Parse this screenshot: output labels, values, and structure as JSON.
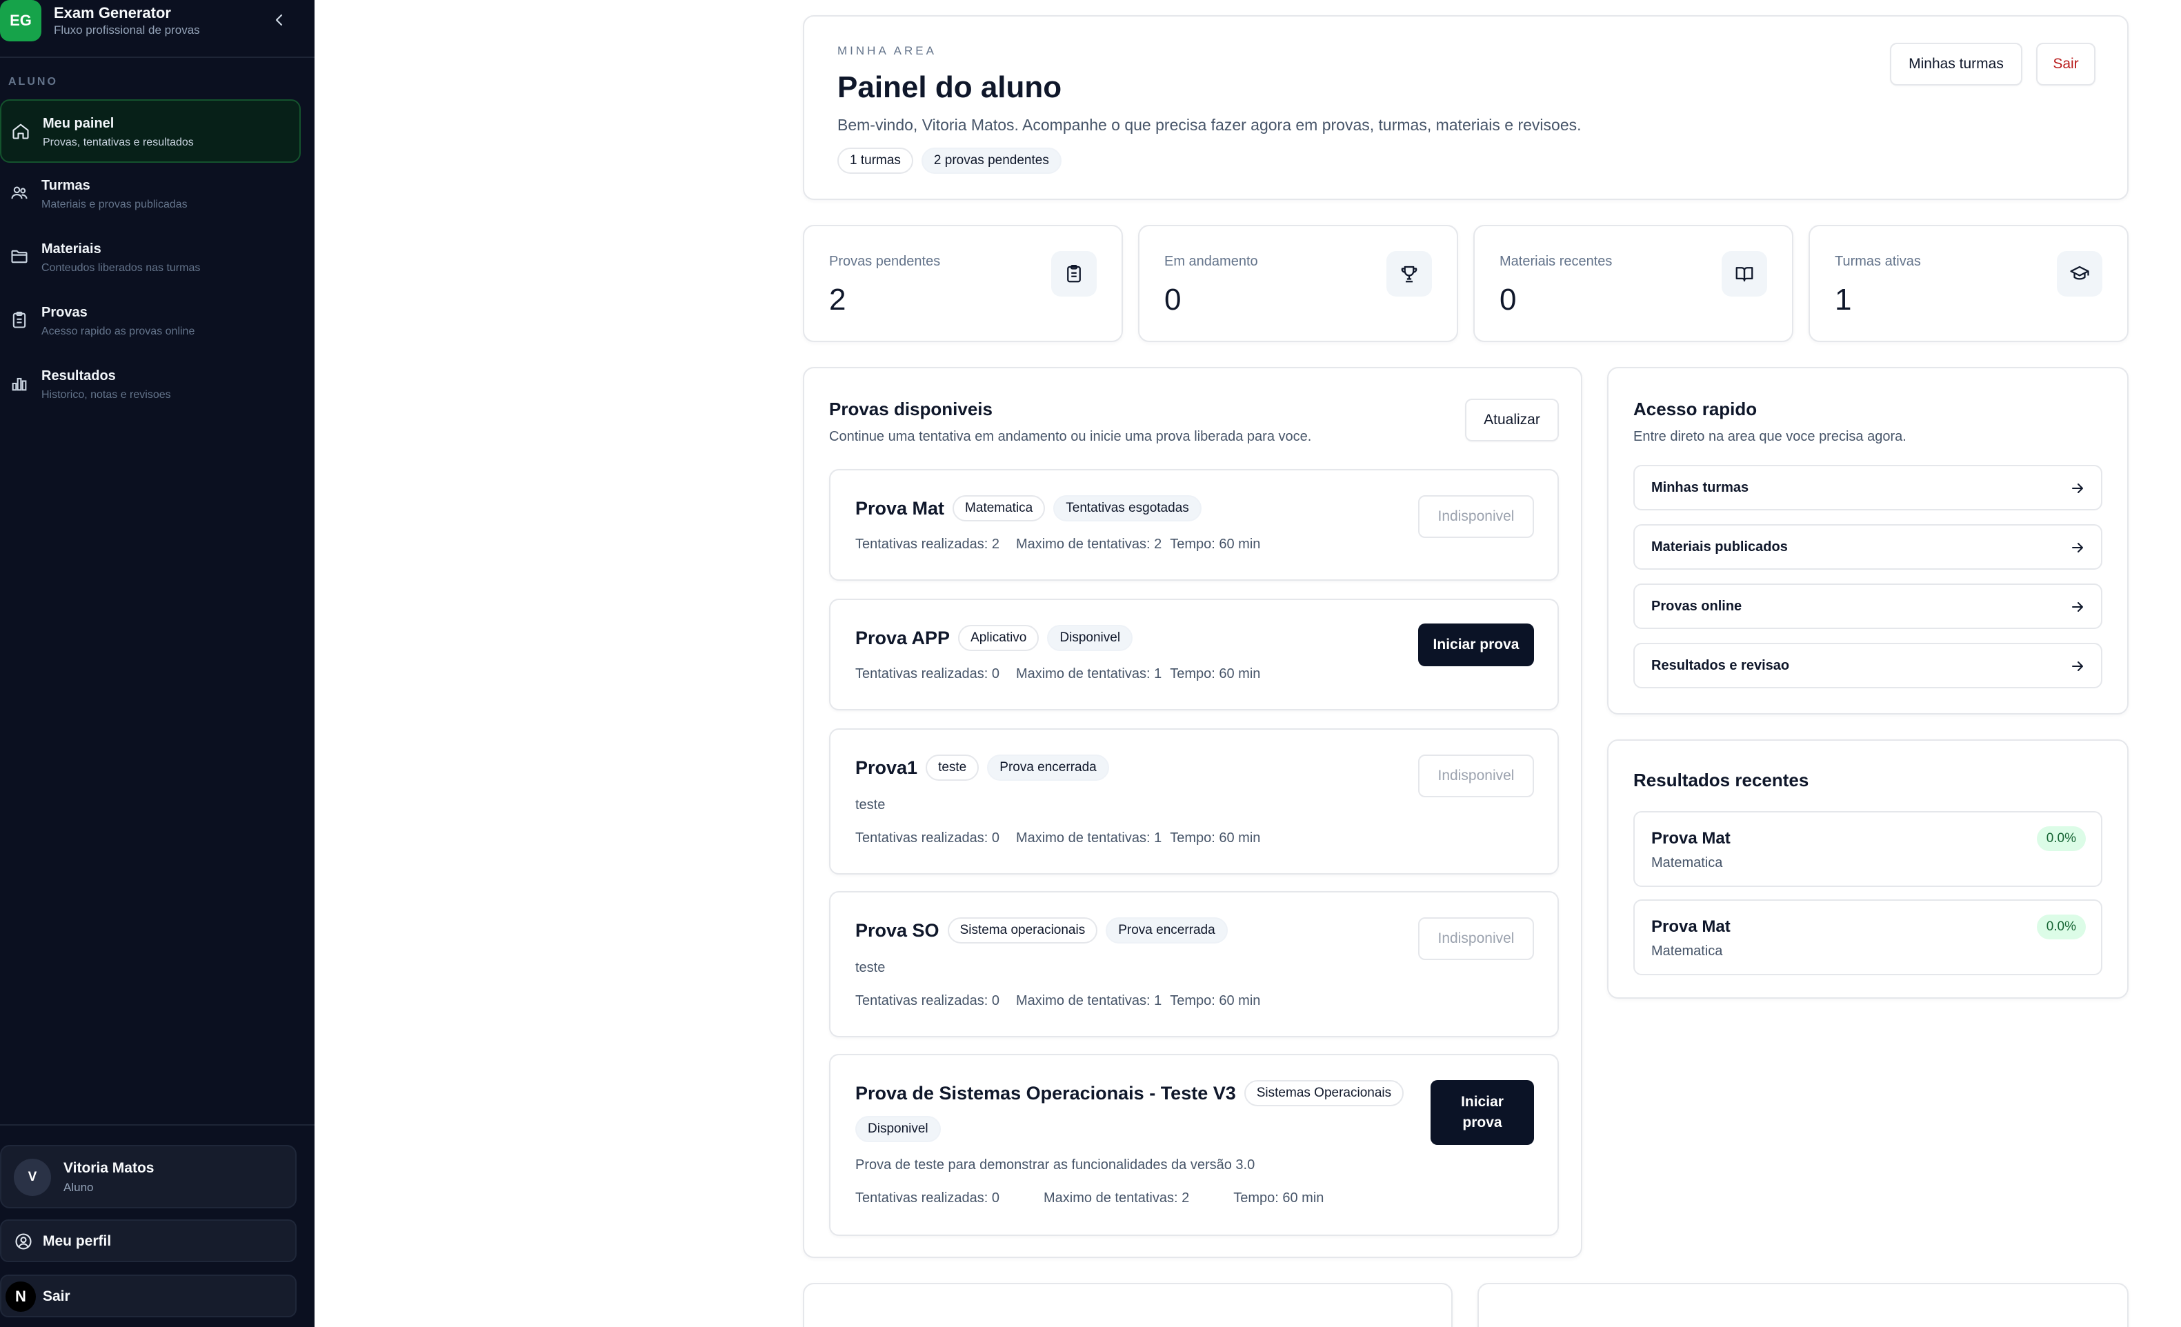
{
  "brand": {
    "logo": "EG",
    "title": "Exam Generator",
    "subtitle": "Fluxo profissional de provas"
  },
  "sidebar": {
    "section": "ALUNO",
    "items": [
      {
        "title": "Meu painel",
        "sub": "Provas, tentativas e resultados",
        "icon": "home-icon"
      },
      {
        "title": "Turmas",
        "sub": "Materiais e provas publicadas",
        "icon": "users-icon"
      },
      {
        "title": "Materiais",
        "sub": "Conteudos liberados nas turmas",
        "icon": "folder-icon"
      },
      {
        "title": "Provas",
        "sub": "Acesso rapido as provas online",
        "icon": "clipboard-icon"
      },
      {
        "title": "Resultados",
        "sub": "Historico, notas e revisoes",
        "icon": "bar-chart-icon"
      }
    ],
    "user": {
      "initial": "V",
      "name": "Vitoria Matos",
      "role": "Aluno"
    },
    "profile_label": "Meu perfil",
    "logout_label": "Sair",
    "logout_badge": "N"
  },
  "header": {
    "eyebrow": "MINHA AREA",
    "title": "Painel do aluno",
    "welcome": "Bem-vindo, Vitoria Matos. Acompanhe o que precisa fazer agora em provas, turmas, materiais e revisoes.",
    "chips": [
      "1 turmas",
      "2 provas pendentes"
    ],
    "btn_classes": "Minhas turmas",
    "btn_logout": "Sair"
  },
  "stats": [
    {
      "label": "Provas pendentes",
      "value": "2",
      "icon": "clipboard-icon"
    },
    {
      "label": "Em andamento",
      "value": "0",
      "icon": "trophy-icon"
    },
    {
      "label": "Materiais recentes",
      "value": "0",
      "icon": "book-open-icon"
    },
    {
      "label": "Turmas ativas",
      "value": "1",
      "icon": "graduation-cap-icon"
    }
  ],
  "exams_section": {
    "title": "Provas disponiveis",
    "subtitle": "Continue uma tentativa em andamento ou inicie uma prova liberada para voce.",
    "refresh": "Atualizar",
    "exams": [
      {
        "name": "Prova Mat",
        "subject": "Matematica",
        "status": "Tentativas esgotadas",
        "desc": "",
        "attempts": "Tentativas realizadas: 2",
        "max": "Maximo de tentativas: 2",
        "time": "Tempo: 60 min",
        "action": "Indisponivel"
      },
      {
        "name": "Prova APP",
        "subject": "Aplicativo",
        "status": "Disponivel",
        "desc": "",
        "attempts": "Tentativas realizadas: 0",
        "max": "Maximo de tentativas: 1",
        "time": "Tempo: 60 min",
        "action": "Iniciar prova"
      },
      {
        "name": "Prova1",
        "subject": "teste",
        "status": "Prova encerrada",
        "desc": "teste",
        "attempts": "Tentativas realizadas: 0",
        "max": "Maximo de tentativas: 1",
        "time": "Tempo: 60 min",
        "action": "Indisponivel"
      },
      {
        "name": "Prova SO",
        "subject": "Sistema operacionais",
        "status": "Prova encerrada",
        "desc": "teste",
        "attempts": "Tentativas realizadas: 0",
        "max": "Maximo de tentativas: 1",
        "time": "Tempo: 60 min",
        "action": "Indisponivel"
      },
      {
        "name": "Prova de Sistemas Operacionais - Teste V3",
        "subject": "Sistemas Operacionais",
        "status": "Disponivel",
        "desc": "Prova de teste para demonstrar as funcionalidades da versão 3.0",
        "attempts": "Tentativas realizadas: 0",
        "max": "Maximo de tentativas: 2",
        "time": "Tempo: 60 min",
        "action": "Iniciar prova"
      }
    ]
  },
  "quick_access": {
    "title": "Acesso rapido",
    "subtitle": "Entre direto na area que voce precisa agora.",
    "links": [
      "Minhas turmas",
      "Materiais publicados",
      "Provas online",
      "Resultados e revisao"
    ]
  },
  "recent_results": {
    "title": "Resultados recentes",
    "items": [
      {
        "name": "Prova Mat",
        "subject": "Matematica",
        "score": "0.0%"
      },
      {
        "name": "Prova Mat",
        "subject": "Matematica",
        "score": "0.0%"
      }
    ]
  },
  "colors": {
    "sidebar_bg": "#0b1020",
    "accent_green": "#16a34a",
    "dark_button": "#0b1326",
    "danger": "#b91c1c",
    "score_bg": "#dcfce7"
  }
}
